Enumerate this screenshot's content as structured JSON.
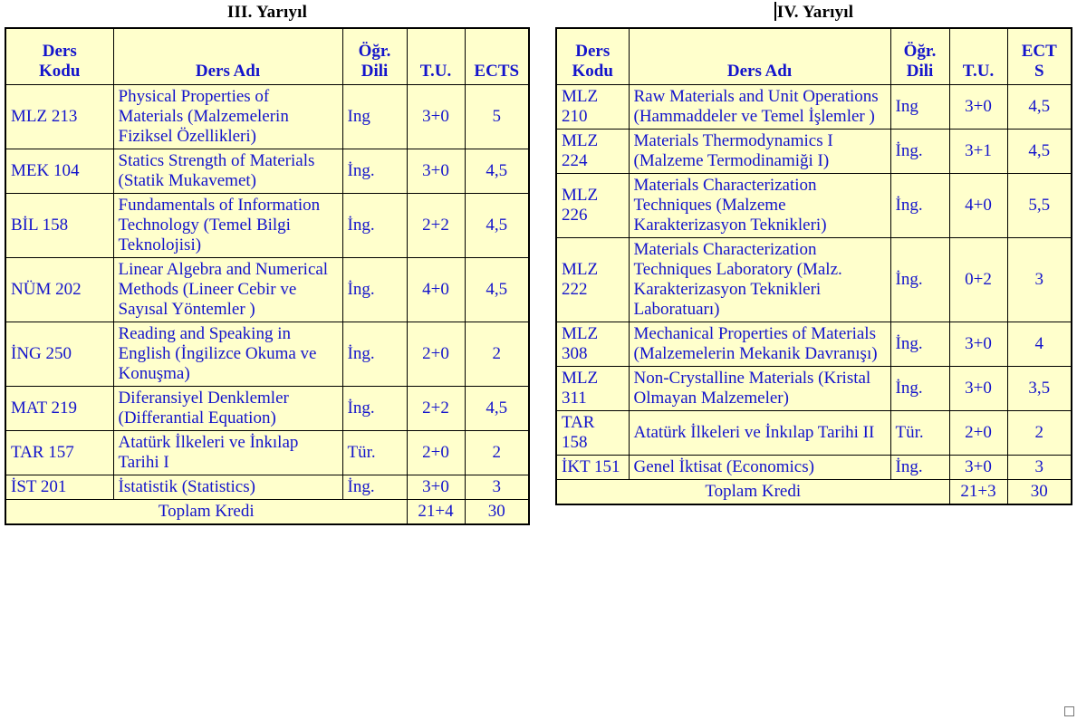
{
  "document": {
    "background_color": "#ffffff",
    "table_fill_color": "#ffffcc",
    "text_color": "#1414cc",
    "title_color": "#000000",
    "border_color": "#000000"
  },
  "semesters": [
    {
      "title": "III. Yarıyıl",
      "has_caret": false,
      "headers": {
        "code": "Ders\nKodu",
        "code_line1": "Ders",
        "code_line2": "Kodu",
        "name": "Ders Adı",
        "lang_line1": "Öğr.",
        "lang_line2": "Dili",
        "tu": "T.U.",
        "ects_line1": "ECTS",
        "ects_line2": ""
      },
      "rows": [
        {
          "code": "MLZ 213",
          "name": "Physical Properties of Materials (Malzemelerin Fiziksel Özellikleri)",
          "lang": "Ing",
          "tu": "3+0",
          "ects": "5"
        },
        {
          "code": "MEK 104",
          "name": "Statics Strength of Materials (Statik Mukavemet)",
          "lang": "İng.",
          "tu": "3+0",
          "ects": "4,5"
        },
        {
          "code": "BİL 158",
          "name": "Fundamentals of Information Technology (Temel Bilgi Teknolojisi)",
          "lang": "İng.",
          "tu": "2+2",
          "ects": "4,5"
        },
        {
          "code": "NÜM 202",
          "name": "Linear Algebra and Numerical Methods (Lineer Cebir ve Sayısal Yöntemler )",
          "lang": "İng.",
          "tu": "4+0",
          "ects": "4,5"
        },
        {
          "code": "İNG 250",
          "name": "Reading and Speaking in English (İngilizce Okuma ve Konuşma)",
          "lang": "İng.",
          "tu": "2+0",
          "ects": "2"
        },
        {
          "code": "MAT 219",
          "name": "Diferansiyel Denklemler (Differantial Equation)",
          "lang": "İng.",
          "tu": "2+2",
          "ects": "4,5"
        },
        {
          "code": "TAR 157",
          "name": "Atatürk İlkeleri ve İnkılap Tarihi I",
          "lang": "Tür.",
          "tu": "2+0",
          "ects": "2"
        },
        {
          "code": "İST 201",
          "name": "İstatistik (Statistics)",
          "lang": "İng.",
          "tu": "3+0",
          "ects": "3"
        }
      ],
      "total": {
        "label": "Toplam Kredi",
        "tu": "21+4",
        "ects": "30"
      }
    },
    {
      "title": "IV. Yarıyıl",
      "has_caret": true,
      "headers": {
        "code": "Ders\nKodu",
        "code_line1": "Ders",
        "code_line2": "Kodu",
        "name": "Ders Adı",
        "lang_line1": "Öğr.",
        "lang_line2": "Dili",
        "tu": "T.U.",
        "ects_line1": "ECT",
        "ects_line2": "S"
      },
      "rows": [
        {
          "code": "MLZ 210",
          "name": "Raw Materials and Unit Operations (Hammaddeler ve Temel İşlemler )",
          "lang": "Ing",
          "tu": "3+0",
          "ects": "4,5"
        },
        {
          "code": "MLZ 224",
          "name": "Materials Thermodynamics I (Malzeme Termodinamiği I)",
          "lang": "İng.",
          "tu": "3+1",
          "ects": "4,5"
        },
        {
          "code": "MLZ 226",
          "name": "Materials Characterization Techniques (Malzeme Karakterizasyon Teknikleri)",
          "lang": "İng.",
          "tu": "4+0",
          "ects": "5,5"
        },
        {
          "code": "MLZ 222",
          "name": "Materials Characterization Techniques Laboratory (Malz. Karakterizasyon Teknikleri Laboratuarı)",
          "lang": "İng.",
          "tu": "0+2",
          "ects": "3"
        },
        {
          "code": "MLZ 308",
          "name": "Mechanical Properties of Materials (Malzemelerin Mekanik Davranışı)",
          "lang": "İng.",
          "tu": "3+0",
          "ects": "4"
        },
        {
          "code": "MLZ 311",
          "name": "Non-Crystalline Materials (Kristal Olmayan Malzemeler)",
          "lang": "İng.",
          "tu": "3+0",
          "ects": "3,5"
        },
        {
          "code": "TAR 158",
          "name": "Atatürk İlkeleri ve İnkılap Tarihi II",
          "lang": "Tür.",
          "tu": "2+0",
          "ects": "2"
        },
        {
          "code": "İKT 151",
          "name": "Genel İktisat (Economics)",
          "lang": "İng.",
          "tu": "3+0",
          "ects": "3"
        }
      ],
      "total": {
        "label": "Toplam Kredi",
        "tu": "21+3",
        "ects": "30"
      }
    }
  ],
  "resize_handle": {
    "name": "resize-handle"
  }
}
